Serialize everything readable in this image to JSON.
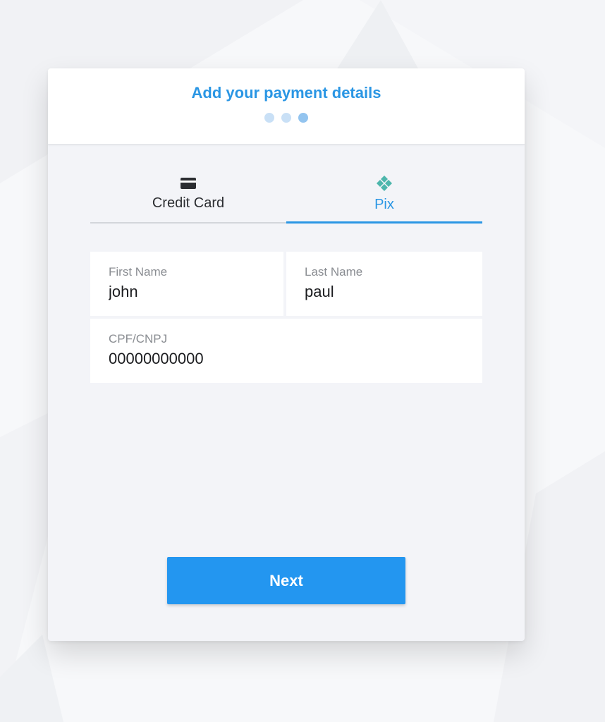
{
  "header": {
    "title": "Add your payment details",
    "steps_total": 3,
    "current_step": 3
  },
  "tabs": [
    {
      "label": "Credit Card",
      "icon": "credit-card-icon",
      "selected": false
    },
    {
      "label": "Pix",
      "icon": "pix-icon",
      "selected": true
    }
  ],
  "form": {
    "first_name": {
      "label": "First Name",
      "value": "john"
    },
    "last_name": {
      "label": "Last Name",
      "value": "paul"
    },
    "cpf_cnpj": {
      "label": "CPF/CNPJ",
      "value": "00000000000"
    }
  },
  "actions": {
    "next_label": "Next"
  },
  "colors": {
    "accent": "#2a96e4",
    "button": "#2396f0",
    "pix_icon": "#4db6ac",
    "step_dot": "#c9e0f6",
    "step_dot_active": "#93c4ef"
  }
}
